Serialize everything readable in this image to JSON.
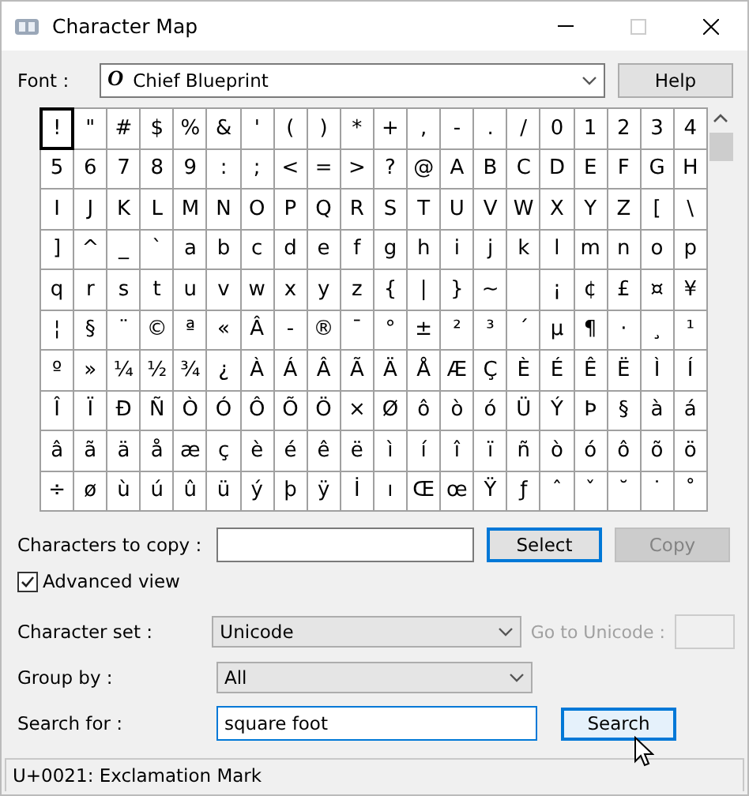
{
  "window": {
    "title": "Character Map",
    "maximize_disabled": true
  },
  "font": {
    "label": "Font :",
    "value": "Chief Blueprint",
    "font_glyph": "O"
  },
  "help_button": "Help",
  "grid": {
    "rows": [
      [
        {
          "char": "!",
          "selected": true
        },
        {
          "char": "\"",
          "selected": false
        },
        {
          "char": "#",
          "selected": false
        },
        {
          "char": "$",
          "selected": false
        },
        {
          "char": "%",
          "selected": false
        },
        {
          "char": "&",
          "selected": false
        },
        {
          "char": "'",
          "selected": false
        },
        {
          "char": "(",
          "selected": false
        },
        {
          "char": ")",
          "selected": false
        },
        {
          "char": "*",
          "selected": false
        },
        {
          "char": "+",
          "selected": false
        },
        {
          "char": ",",
          "selected": false
        },
        {
          "char": "-",
          "selected": false
        },
        {
          "char": ".",
          "selected": false
        },
        {
          "char": "/",
          "selected": false
        },
        {
          "char": "0",
          "selected": false
        },
        {
          "char": "1",
          "selected": false
        },
        {
          "char": "2",
          "selected": false
        },
        {
          "char": "3",
          "selected": false
        },
        {
          "char": "4",
          "selected": false
        }
      ],
      [
        {
          "char": "5",
          "selected": false
        },
        {
          "char": "6",
          "selected": false
        },
        {
          "char": "7",
          "selected": false
        },
        {
          "char": "8",
          "selected": false
        },
        {
          "char": "9",
          "selected": false
        },
        {
          "char": ":",
          "selected": false
        },
        {
          "char": ";",
          "selected": false
        },
        {
          "char": "<",
          "selected": false
        },
        {
          "char": "=",
          "selected": false
        },
        {
          "char": ">",
          "selected": false
        },
        {
          "char": "?",
          "selected": false
        },
        {
          "char": "@",
          "selected": false
        },
        {
          "char": "A",
          "selected": false
        },
        {
          "char": "B",
          "selected": false
        },
        {
          "char": "C",
          "selected": false
        },
        {
          "char": "D",
          "selected": false
        },
        {
          "char": "E",
          "selected": false
        },
        {
          "char": "F",
          "selected": false
        },
        {
          "char": "G",
          "selected": false
        },
        {
          "char": "H",
          "selected": false
        }
      ],
      [
        {
          "char": "I",
          "selected": false
        },
        {
          "char": "J",
          "selected": false
        },
        {
          "char": "K",
          "selected": false
        },
        {
          "char": "L",
          "selected": false
        },
        {
          "char": "M",
          "selected": false
        },
        {
          "char": "N",
          "selected": false
        },
        {
          "char": "O",
          "selected": false
        },
        {
          "char": "P",
          "selected": false
        },
        {
          "char": "Q",
          "selected": false
        },
        {
          "char": "R",
          "selected": false
        },
        {
          "char": "S",
          "selected": false
        },
        {
          "char": "T",
          "selected": false
        },
        {
          "char": "U",
          "selected": false
        },
        {
          "char": "V",
          "selected": false
        },
        {
          "char": "W",
          "selected": false
        },
        {
          "char": "X",
          "selected": false
        },
        {
          "char": "Y",
          "selected": false
        },
        {
          "char": "Z",
          "selected": false
        },
        {
          "char": "[",
          "selected": false
        },
        {
          "char": "\\",
          "selected": false
        }
      ],
      [
        {
          "char": "]",
          "selected": false
        },
        {
          "char": "^",
          "selected": false
        },
        {
          "char": "_",
          "selected": false
        },
        {
          "char": "`",
          "selected": false
        },
        {
          "char": "a",
          "selected": false
        },
        {
          "char": "b",
          "selected": false
        },
        {
          "char": "c",
          "selected": false
        },
        {
          "char": "d",
          "selected": false
        },
        {
          "char": "e",
          "selected": false
        },
        {
          "char": "f",
          "selected": false
        },
        {
          "char": "g",
          "selected": false
        },
        {
          "char": "h",
          "selected": false
        },
        {
          "char": "i",
          "selected": false
        },
        {
          "char": "j",
          "selected": false
        },
        {
          "char": "k",
          "selected": false
        },
        {
          "char": "l",
          "selected": false
        },
        {
          "char": "m",
          "selected": false
        },
        {
          "char": "n",
          "selected": false
        },
        {
          "char": "o",
          "selected": false
        },
        {
          "char": "p",
          "selected": false
        }
      ],
      [
        {
          "char": "q",
          "selected": false
        },
        {
          "char": "r",
          "selected": false
        },
        {
          "char": "s",
          "selected": false
        },
        {
          "char": "t",
          "selected": false
        },
        {
          "char": "u",
          "selected": false
        },
        {
          "char": "v",
          "selected": false
        },
        {
          "char": "w",
          "selected": false
        },
        {
          "char": "x",
          "selected": false
        },
        {
          "char": "y",
          "selected": false
        },
        {
          "char": "z",
          "selected": false
        },
        {
          "char": "{",
          "selected": false
        },
        {
          "char": "|",
          "selected": false
        },
        {
          "char": "}",
          "selected": false
        },
        {
          "char": "~",
          "selected": false
        },
        {
          "selected": false
        },
        {
          "char": "¡",
          "selected": false
        },
        {
          "char": "¢",
          "selected": false
        },
        {
          "char": "£",
          "selected": false
        },
        {
          "char": "¤",
          "selected": false
        },
        {
          "char": "¥",
          "selected": false
        }
      ],
      [
        {
          "char": "¦",
          "selected": false
        },
        {
          "char": "§",
          "selected": false
        },
        {
          "char": "¨",
          "selected": false
        },
        {
          "char": "©",
          "selected": false
        },
        {
          "char": "ª",
          "selected": false
        },
        {
          "char": "«",
          "selected": false
        },
        {
          "char": "Â",
          "selected": false
        },
        {
          "char": "-",
          "selected": false
        },
        {
          "char": "®",
          "selected": false
        },
        {
          "char": "¯",
          "selected": false
        },
        {
          "char": "°",
          "selected": false
        },
        {
          "char": "±",
          "selected": false
        },
        {
          "char": "²",
          "selected": false
        },
        {
          "char": "³",
          "selected": false
        },
        {
          "char": "´",
          "selected": false
        },
        {
          "char": "µ",
          "selected": false
        },
        {
          "char": "¶",
          "selected": false
        },
        {
          "char": "·",
          "selected": false
        },
        {
          "char": "¸",
          "selected": false
        },
        {
          "char": "¹",
          "selected": false
        }
      ],
      [
        {
          "char": "º",
          "selected": false
        },
        {
          "char": "»",
          "selected": false
        },
        {
          "char": "¼",
          "selected": false
        },
        {
          "char": "½",
          "selected": false
        },
        {
          "char": "¾",
          "selected": false
        },
        {
          "char": "¿",
          "selected": false
        },
        {
          "char": "À",
          "selected": false
        },
        {
          "char": "Á",
          "selected": false
        },
        {
          "char": "Â",
          "selected": false
        },
        {
          "char": "Ã",
          "selected": false
        },
        {
          "char": "Ä",
          "selected": false
        },
        {
          "char": "Å",
          "selected": false
        },
        {
          "char": "Æ",
          "selected": false
        },
        {
          "char": "Ç",
          "selected": false
        },
        {
          "char": "È",
          "selected": false
        },
        {
          "char": "É",
          "selected": false
        },
        {
          "char": "Ê",
          "selected": false
        },
        {
          "char": "Ë",
          "selected": false
        },
        {
          "char": "Ì",
          "selected": false
        },
        {
          "char": "Í",
          "selected": false
        }
      ],
      [
        {
          "char": "Î",
          "selected": false
        },
        {
          "char": "Ï",
          "selected": false
        },
        {
          "char": "Ð",
          "selected": false
        },
        {
          "char": "Ñ",
          "selected": false
        },
        {
          "char": "Ò",
          "selected": false
        },
        {
          "char": "Ó",
          "selected": false
        },
        {
          "char": "Ô",
          "selected": false
        },
        {
          "char": "Õ",
          "selected": false
        },
        {
          "char": "Ö",
          "selected": false
        },
        {
          "char": "×",
          "selected": false
        },
        {
          "char": "Ø",
          "selected": false
        },
        {
          "char": "ô",
          "selected": false
        },
        {
          "char": "ò",
          "selected": false
        },
        {
          "char": "ó",
          "selected": false
        },
        {
          "char": "Ü",
          "selected": false
        },
        {
          "char": "Ý",
          "selected": false
        },
        {
          "char": "Þ",
          "selected": false
        },
        {
          "char": "§",
          "selected": false
        },
        {
          "char": "à",
          "selected": false
        },
        {
          "char": "á",
          "selected": false
        }
      ],
      [
        {
          "char": "â",
          "selected": false
        },
        {
          "char": "ã",
          "selected": false
        },
        {
          "char": "ä",
          "selected": false
        },
        {
          "char": "å",
          "selected": false
        },
        {
          "char": "æ",
          "selected": false
        },
        {
          "char": "ç",
          "selected": false
        },
        {
          "char": "è",
          "selected": false
        },
        {
          "char": "é",
          "selected": false
        },
        {
          "char": "ê",
          "selected": false
        },
        {
          "char": "ë",
          "selected": false
        },
        {
          "char": "ì",
          "selected": false
        },
        {
          "char": "í",
          "selected": false
        },
        {
          "char": "î",
          "selected": false
        },
        {
          "char": "ï",
          "selected": false
        },
        {
          "char": "ñ",
          "selected": false
        },
        {
          "char": "ò",
          "selected": false
        },
        {
          "char": "ó",
          "selected": false
        },
        {
          "char": "ô",
          "selected": false
        },
        {
          "char": "õ",
          "selected": false
        },
        {
          "char": "ö",
          "selected": false
        }
      ],
      [
        {
          "char": "÷",
          "selected": false
        },
        {
          "char": "ø",
          "selected": false
        },
        {
          "char": "ù",
          "selected": false
        },
        {
          "char": "ú",
          "selected": false
        },
        {
          "char": "û",
          "selected": false
        },
        {
          "char": "ü",
          "selected": false
        },
        {
          "char": "ý",
          "selected": false
        },
        {
          "char": "þ",
          "selected": false
        },
        {
          "char": "ÿ",
          "selected": false
        },
        {
          "char": "İ",
          "selected": false
        },
        {
          "char": "ı",
          "selected": false
        },
        {
          "char": "Œ",
          "selected": false
        },
        {
          "char": "œ",
          "selected": false
        },
        {
          "char": "Ÿ",
          "selected": false
        },
        {
          "char": "ƒ",
          "selected": false
        },
        {
          "char": "ˆ",
          "selected": false
        },
        {
          "char": "ˇ",
          "selected": false
        },
        {
          "char": "˘",
          "selected": false
        },
        {
          "char": "˙",
          "selected": false
        },
        {
          "char": "˚",
          "selected": false
        }
      ]
    ]
  },
  "copy_row": {
    "label": "Characters to copy :",
    "select_button": "Select",
    "copy_button": {
      "label": "Copy",
      "disabled": true
    }
  },
  "advanced_view": {
    "label": "Advanced view",
    "checked": true
  },
  "character_set": {
    "label": "Character set :",
    "value": "Unicode"
  },
  "go_to_unicode": {
    "label": "Go to Unicode :",
    "disabled": true
  },
  "group_by": {
    "label": "Group by :",
    "value": "All"
  },
  "search": {
    "label": "Search for :",
    "value": "square foot",
    "button": "Search",
    "button_hovered": true
  },
  "status_bar": "U+0021: Exclamation Mark"
}
